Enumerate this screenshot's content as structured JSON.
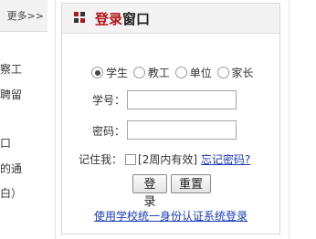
{
  "left_column": {
    "more_link": "更多>>",
    "snippets": [
      "察工",
      "聘留",
      "口",
      "的通",
      "白）"
    ]
  },
  "login_panel": {
    "title_highlight": "登录",
    "title_rest": "窗口",
    "roles": [
      {
        "label": "学生",
        "selected": true
      },
      {
        "label": "教工",
        "selected": false
      },
      {
        "label": "单位",
        "selected": false
      },
      {
        "label": "家长",
        "selected": false
      }
    ],
    "student_id_label": "学号：",
    "student_id_value": "",
    "password_label": "密码：",
    "password_value": "",
    "remember_label": "记住我：",
    "remember_checked": false,
    "remember_note": "[2周内有效]",
    "forgot_link": "忘记密码?",
    "login_button": "登录",
    "reset_button": "重置",
    "unified_auth_link": "使用学校统一身份认证系统登录"
  },
  "colors": {
    "title_accent": "#b2161b",
    "link": "#1a3bb3",
    "icon_red": "#b2161b",
    "icon_dark": "#333333"
  }
}
